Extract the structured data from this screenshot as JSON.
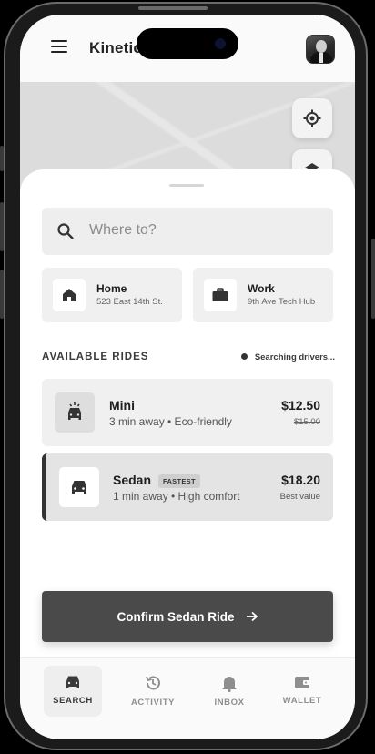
{
  "app": {
    "brand": "Kinetic"
  },
  "search": {
    "placeholder": "Where to?"
  },
  "places": [
    {
      "name": "Home",
      "address": "523 East 14th St.",
      "icon": "home-icon"
    },
    {
      "name": "Work",
      "address": "9th Ave Tech Hub",
      "icon": "briefcase-icon"
    }
  ],
  "rides_section": {
    "title": "AVAILABLE RIDES",
    "status": "Searching drivers..."
  },
  "rides": [
    {
      "name": "Mini",
      "details": "3 min away • Eco-friendly",
      "price": "$12.50",
      "old_price": "$15.00",
      "icon": "car-icon"
    },
    {
      "name": "Sedan",
      "badge": "FASTEST",
      "details": "1 min away • High comfort",
      "price": "$18.20",
      "note": "Best value",
      "selected": true,
      "icon": "car-icon"
    }
  ],
  "confirm": {
    "label": "Confirm Sedan Ride"
  },
  "nav": [
    {
      "label": "SEARCH",
      "icon": "car-icon",
      "active": true
    },
    {
      "label": "ACTIVITY",
      "icon": "history-icon"
    },
    {
      "label": "INBOX",
      "icon": "bell-icon"
    },
    {
      "label": "WALLET",
      "icon": "wallet-icon"
    }
  ],
  "colors": {
    "accent": "#4a4a4a",
    "selected_border": "#333333"
  }
}
